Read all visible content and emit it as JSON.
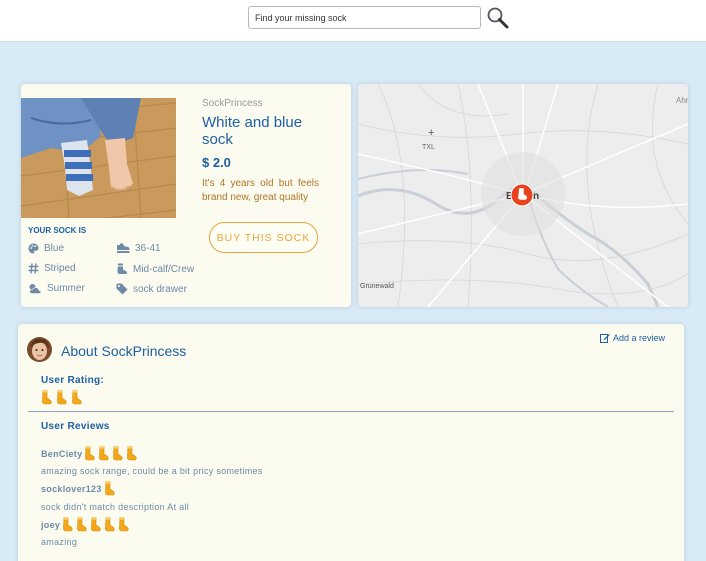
{
  "search": {
    "placeholder": "Find your missing sock"
  },
  "product": {
    "seller": "SockPrincess",
    "title": "White and blue sock",
    "price": "$ 2.0",
    "description": "It's 4 years old but feels brand new, great quality",
    "buy_label": "BUY THIS SOCK",
    "attributes_heading": "YOUR SOCK IS",
    "attributes": {
      "color": "Blue",
      "size": "36-41",
      "pattern": "Striped",
      "length": "Mid-calf/Crew",
      "season": "Summer",
      "tag": "sock drawer"
    }
  },
  "map": {
    "labels": [
      "TXL",
      "Grunewald",
      "Ahr",
      "B",
      "n"
    ]
  },
  "about": {
    "title": "About SockPrincess",
    "add_review_label": "Add a review",
    "user_rating_label": "User Rating:",
    "user_rating": 3,
    "reviews_label": "User Reviews",
    "reviews": [
      {
        "user": "BenCiety",
        "rating": 4,
        "text": "amazing sock range, could be a bit pricy sometimes"
      },
      {
        "user": "socklover123",
        "rating": 1,
        "text": "sock didn't match description At all"
      },
      {
        "user": "joey",
        "rating": 5,
        "text": "amazing"
      }
    ]
  },
  "colors": {
    "brand_blue": "#1f5fa3",
    "accent_orange": "#e8a33c",
    "marker_red": "#e8421f"
  }
}
